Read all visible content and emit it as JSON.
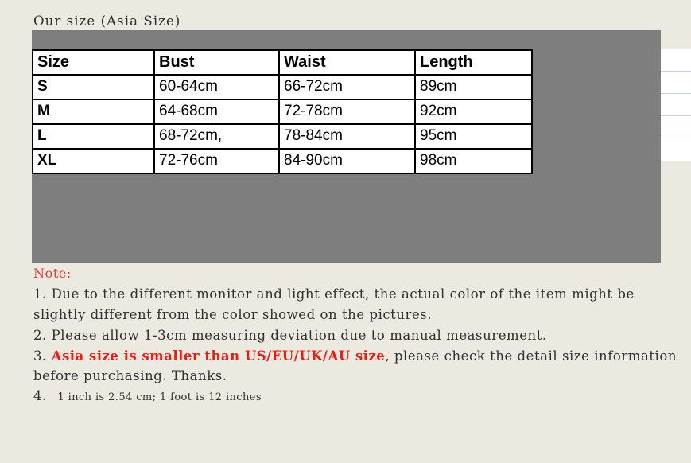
{
  "page": {
    "title": "Our size (Asia Size)",
    "background_color": "#ECEAE0",
    "panel_color": "#7E7E7E",
    "note_heading_color": "#E8382B",
    "highlight_color": "#F01A10"
  },
  "size_table": {
    "columns": [
      "Size",
      "Bust",
      "Waist",
      "Length"
    ],
    "rows": [
      {
        "size": "S",
        "bust": "60-64cm",
        "waist": "66-72cm",
        "length": "89cm"
      },
      {
        "size": "M",
        "bust": "64-68cm",
        "waist": "72-78cm",
        "length": "92cm"
      },
      {
        "size": "L",
        "bust": "68-72cm,",
        "waist": "78-84cm",
        "length": "95cm"
      },
      {
        "size": "XL",
        "bust": "72-76cm",
        "waist": "84-90cm",
        "length": "98cm"
      }
    ]
  },
  "notes": {
    "heading": "Note:",
    "line1": "1. Due to the different monitor and light effect, the actual color of the item might be slightly different from the color showed on the pictures.",
    "line2": "2. Please allow 1-3cm measuring deviation due to manual measurement.",
    "line3_prefix": "3. ",
    "line3_highlight": "Asia size is smaller than US/EU/UK/AU size",
    "line3_suffix": ", please check the detail size information before purchasing. Thanks.",
    "line4_number": "4.",
    "line4_text": "1 inch is 2.54 cm; 1 foot  is 12 inches"
  }
}
